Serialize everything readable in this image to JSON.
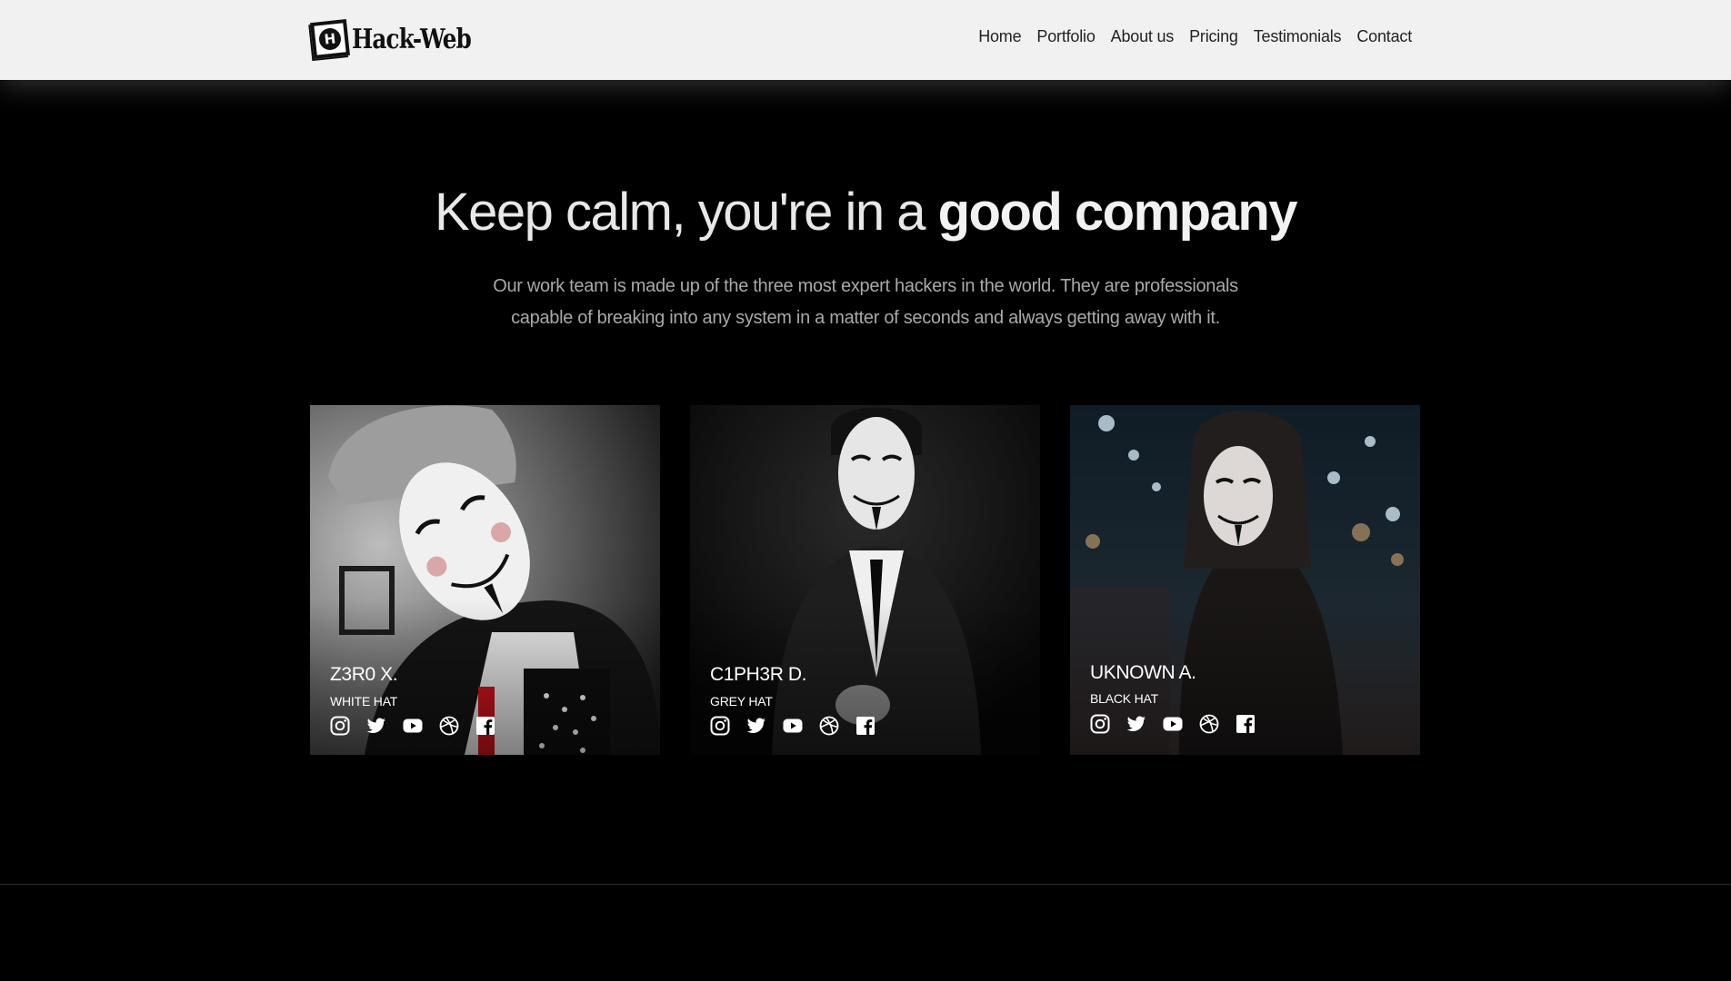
{
  "header": {
    "logo_letter": "H",
    "logo_text": "Hack-Web",
    "nav": [
      {
        "label": "Home"
      },
      {
        "label": "Portfolio"
      },
      {
        "label": "About us"
      },
      {
        "label": "Pricing"
      },
      {
        "label": "Testimonials"
      },
      {
        "label": "Contact"
      }
    ]
  },
  "hero": {
    "title_regular": "Keep calm, you're in a ",
    "title_bold": "good company",
    "description": "Our work team is made up of the three most expert hackers in the world. They are professionals capable of breaking into any system in a matter of seconds and always getting away with it."
  },
  "team": [
    {
      "name": "Z3R0 X.",
      "role": "WHITE HAT"
    },
    {
      "name": "C1PH3R D.",
      "role": "GREY HAT"
    },
    {
      "name": "UKNOWN A.",
      "role": "BLACK HAT"
    }
  ],
  "social_icons": [
    "instagram-icon",
    "twitter-icon",
    "youtube-icon",
    "dribbble-icon",
    "facebook-icon"
  ],
  "colors": {
    "header_bg": "#f1f1f1",
    "page_bg": "#000000",
    "title_text": "#e8e8e8",
    "body_text": "#a9a9a9"
  }
}
